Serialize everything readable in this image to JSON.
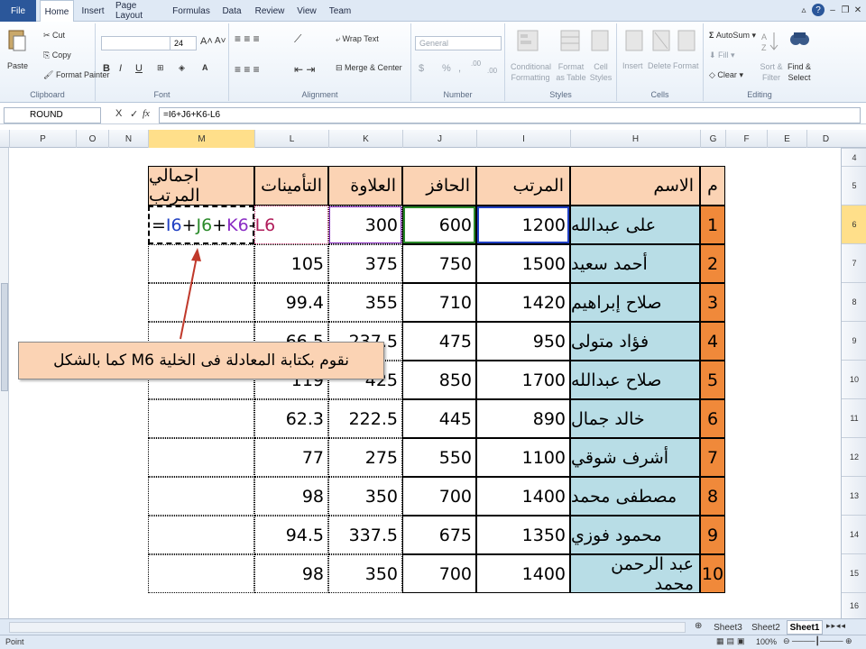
{
  "tabs": [
    "File",
    "Home",
    "Insert",
    "Page Layout",
    "Formulas",
    "Data",
    "Review",
    "View",
    "Team"
  ],
  "active_tab": "Home",
  "ribbon": {
    "clipboard": {
      "paste": "Paste",
      "cut": "Cut",
      "copy": "Copy",
      "format_painter": "Format Painter",
      "label": "Clipboard"
    },
    "font": {
      "size": "24",
      "bold": "B",
      "italic": "I",
      "underline": "U",
      "grow": "A",
      "shrink": "A",
      "label": "Font"
    },
    "alignment": {
      "wrap": "Wrap Text",
      "merge": "Merge & Center",
      "label": "Alignment"
    },
    "number": {
      "format": "General",
      "currency": "$",
      "percent": "%",
      "comma": ",",
      "inc_dec": ".00",
      "dec_dec": ".00",
      "label": "Number"
    },
    "styles": {
      "conditional": "Conditional Formatting",
      "format_table": "Format as Table",
      "cell_styles": "Cell Styles",
      "label": "Styles"
    },
    "cells": {
      "insert": "Insert",
      "delete": "Delete",
      "format": "Format",
      "label": "Cells"
    },
    "editing": {
      "autosum": "AutoSum",
      "fill": "Fill",
      "clear": "Clear",
      "sort": "Sort & Filter",
      "find": "Find & Select",
      "label": "Editing"
    }
  },
  "formula_bar": {
    "name_box": "ROUND",
    "cancel": "X",
    "enter": "✓",
    "fx": "fx",
    "formula": "=I6+J6+K6-L6"
  },
  "columns": [
    "P",
    "O",
    "N",
    "M",
    "L",
    "K",
    "J",
    "I",
    "H",
    "G",
    "F",
    "E",
    "D"
  ],
  "rows": [
    "4",
    "5",
    "6",
    "7",
    "8",
    "9",
    "10",
    "11",
    "12",
    "13",
    "14",
    "15",
    "16"
  ],
  "table": {
    "headers": {
      "idx": "م",
      "name": "الاسم",
      "salary": "المرتب",
      "incentive": "الحافز",
      "bonus": "العلاوة",
      "insurance": "التأمينات",
      "total": "اجمالي المرتب"
    },
    "rows": [
      {
        "idx": "1",
        "name": "على عبدالله",
        "salary": "1200",
        "incentive": "600",
        "bonus": "300",
        "insurance": "",
        "total": ""
      },
      {
        "idx": "2",
        "name": "أحمد سعيد",
        "salary": "1500",
        "incentive": "750",
        "bonus": "375",
        "insurance": "105",
        "total": ""
      },
      {
        "idx": "3",
        "name": "صلاح إبراهيم",
        "salary": "1420",
        "incentive": "710",
        "bonus": "355",
        "insurance": "99.4",
        "total": ""
      },
      {
        "idx": "4",
        "name": "فؤاد متولى",
        "salary": "950",
        "incentive": "475",
        "bonus": "237.5",
        "insurance": "66.5",
        "total": ""
      },
      {
        "idx": "5",
        "name": "صلاح عبدالله",
        "salary": "1700",
        "incentive": "850",
        "bonus": "425",
        "insurance": "119",
        "total": ""
      },
      {
        "idx": "6",
        "name": "خالد جمال",
        "salary": "890",
        "incentive": "445",
        "bonus": "222.5",
        "insurance": "62.3",
        "total": ""
      },
      {
        "idx": "7",
        "name": "أشرف شوقي",
        "salary": "1100",
        "incentive": "550",
        "bonus": "275",
        "insurance": "77",
        "total": ""
      },
      {
        "idx": "8",
        "name": "مصطفى محمد",
        "salary": "1400",
        "incentive": "700",
        "bonus": "350",
        "insurance": "98",
        "total": ""
      },
      {
        "idx": "9",
        "name": "محمود فوزي",
        "salary": "1350",
        "incentive": "675",
        "bonus": "337.5",
        "insurance": "94.5",
        "total": ""
      },
      {
        "idx": "10",
        "name": "عبد الرحمن محمد",
        "salary": "1400",
        "incentive": "700",
        "bonus": "350",
        "insurance": "98",
        "total": ""
      }
    ],
    "editing_formula": {
      "eq": "=",
      "i": "I6",
      "p1": "+",
      "j": "J6",
      "p2": "+",
      "k": "K6",
      "m": "-",
      "l": "L6"
    }
  },
  "callout": "نقوم بكتابة المعادلة فى الخلية M6 كما بالشكل",
  "sheet_tabs": [
    "Sheet3",
    "Sheet2",
    "Sheet1"
  ],
  "active_sheet": "Sheet1",
  "status": {
    "mode": "Point",
    "zoom": "100%"
  },
  "colors": {
    "header_fill": "#fbd3b4",
    "name_fill": "#b8dde6",
    "index_fill": "#f0893a",
    "ref_i": "#1f3fc2",
    "ref_j": "#2a8a2a",
    "ref_k": "#8a2cc4",
    "ref_l": "#b01c5a"
  }
}
